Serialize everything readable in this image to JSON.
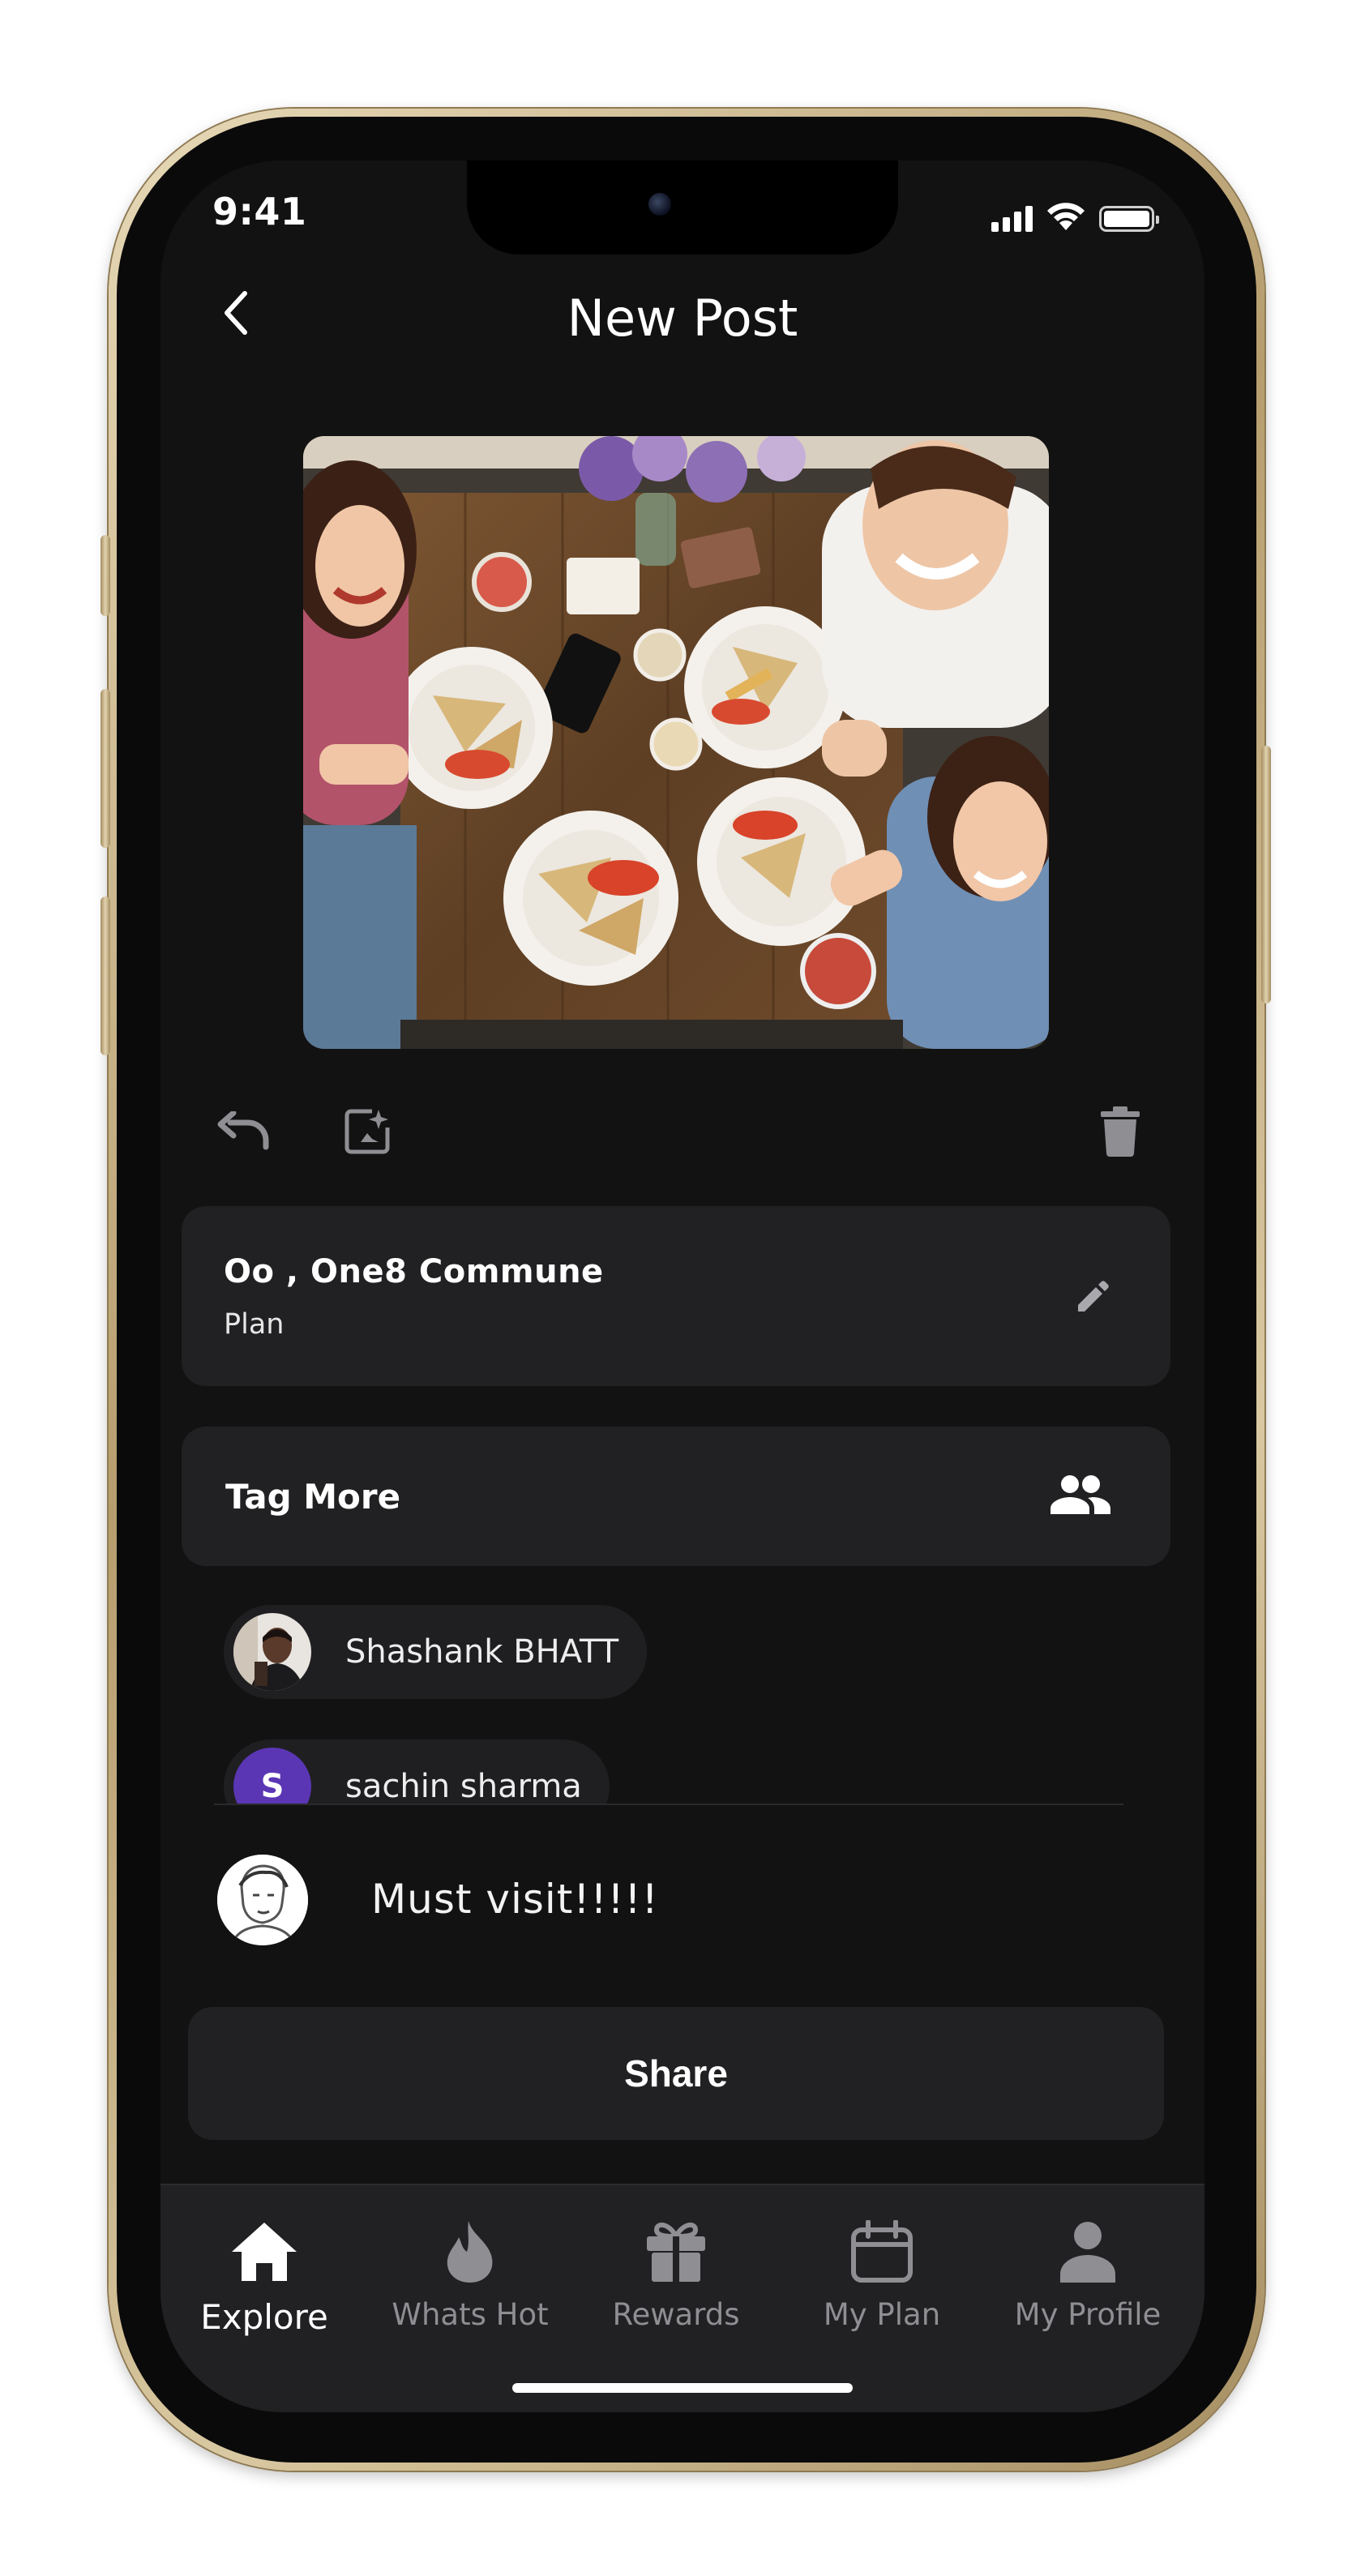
{
  "status_bar": {
    "time": "9:41"
  },
  "header": {
    "title": "New Post",
    "back_icon": "chevron-left-icon"
  },
  "photo": {
    "description_icon": "group-dinner-photo"
  },
  "toolbar": {
    "undo_icon": "undo-icon",
    "enhance_icon": "magic-edit-icon",
    "delete_icon": "trash-icon"
  },
  "plan_card": {
    "title": "Oo , One8 Commune",
    "subtitle": "Plan",
    "edit_icon": "pencil-icon"
  },
  "tag_card": {
    "title": "Tag More",
    "people_icon": "people-icon"
  },
  "tagged_users": [
    {
      "name": "Shashank BHATT",
      "avatar": "photo"
    },
    {
      "name": "sachin sharma",
      "avatar_letter": "S",
      "avatar_color": "#5a36b4"
    }
  ],
  "comment": {
    "text": "Must visit!!!!!"
  },
  "share": {
    "label": "Share"
  },
  "tabs": [
    {
      "label": "Explore",
      "icon": "home-icon",
      "active": true
    },
    {
      "label": "Whats Hot",
      "icon": "flame-icon",
      "active": false
    },
    {
      "label": "Rewards",
      "icon": "gift-icon",
      "active": false
    },
    {
      "label": "My Plan",
      "icon": "calendar-icon",
      "active": false
    },
    {
      "label": "My Profile",
      "icon": "person-icon",
      "active": false
    }
  ],
  "colors": {
    "background": "#121212",
    "card": "#212123",
    "inactive_tab": "#8e8e93",
    "accent_avatar": "#5a36b4"
  }
}
